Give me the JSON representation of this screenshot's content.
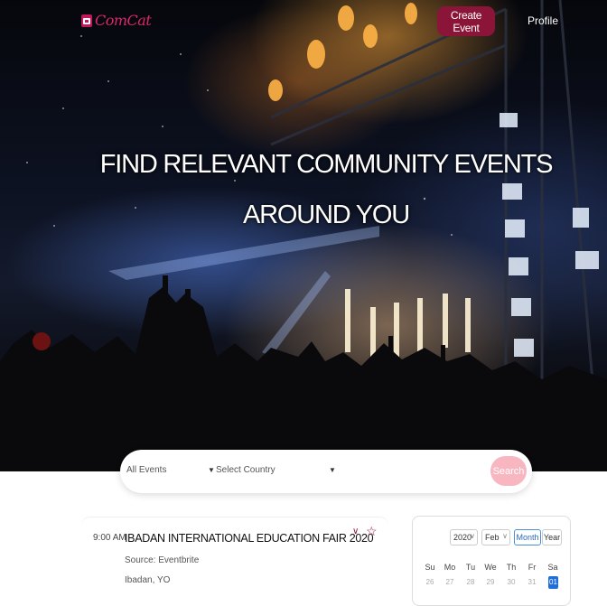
{
  "header": {
    "logo_text": "ComCat",
    "create_event_label": "Create Event",
    "profile_label": "Profile"
  },
  "hero": {
    "title_line1": "FIND RELEVANT COMMUNITY EVENTS",
    "title_line2": "AROUND YOU"
  },
  "search": {
    "events_value": "All Events",
    "country_placeholder": "Select Country",
    "button_label": "Search"
  },
  "event": {
    "time": "9:00 AM",
    "title": "IBADAN INTERNATIONAL EDUCATION FAIR 2020",
    "source": "Source: Eventbrite",
    "location": "Ibadan, YO"
  },
  "calendar": {
    "year": "2020",
    "month": "Feb",
    "view_month": "Month",
    "view_year": "Year",
    "weekdays": [
      "Su",
      "Mo",
      "Tu",
      "We",
      "Th",
      "Fr",
      "Sa"
    ],
    "days": [
      "26",
      "27",
      "28",
      "29",
      "30",
      "31",
      "01"
    ]
  },
  "colors": {
    "brand": "#8b1538",
    "logo": "#d8276a",
    "search_button": "#f8b6c0",
    "selected_day": "#1e6fd9"
  }
}
